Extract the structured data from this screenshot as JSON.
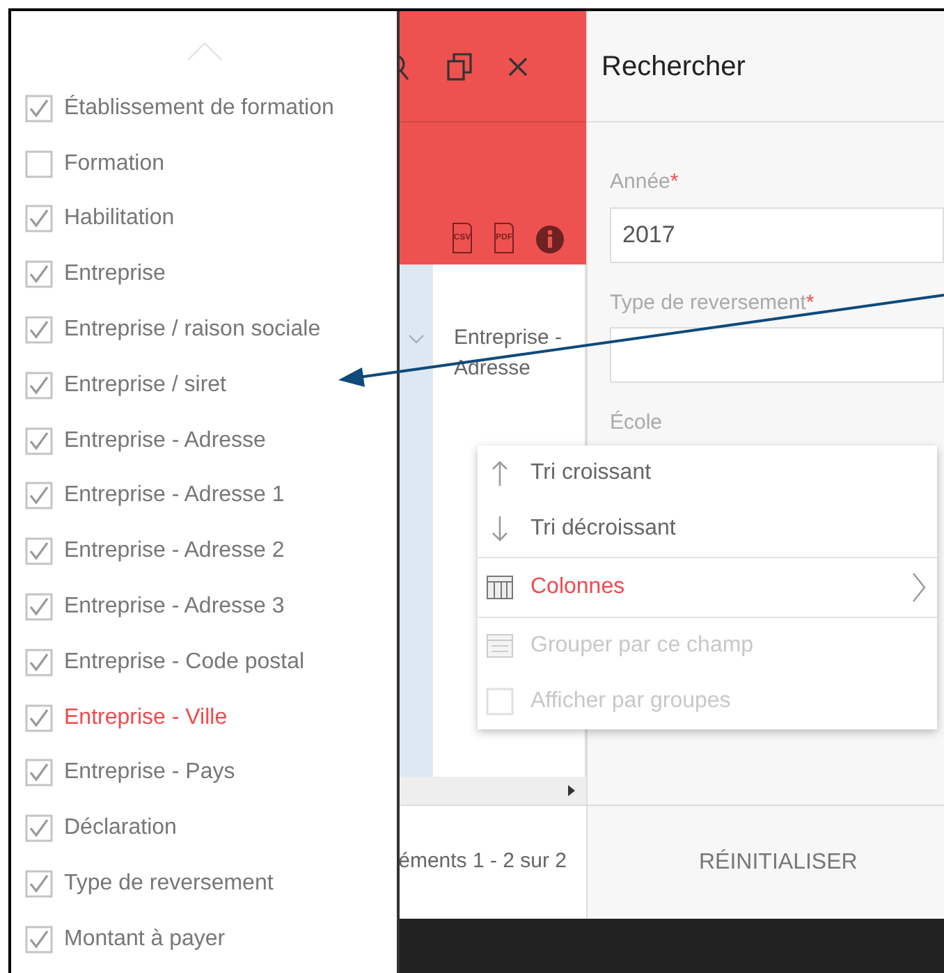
{
  "columns_panel": {
    "items": [
      {
        "label": "Établissement de formation",
        "checked": true,
        "highlighted": false
      },
      {
        "label": "Formation",
        "checked": false,
        "highlighted": false
      },
      {
        "label": "Habilitation",
        "checked": true,
        "highlighted": false
      },
      {
        "label": "Entreprise",
        "checked": true,
        "highlighted": false
      },
      {
        "label": "Entreprise / raison sociale",
        "checked": true,
        "highlighted": false
      },
      {
        "label": "Entreprise / siret",
        "checked": true,
        "highlighted": false
      },
      {
        "label": "Entreprise - Adresse",
        "checked": true,
        "highlighted": false
      },
      {
        "label": "Entreprise - Adresse 1",
        "checked": true,
        "highlighted": false
      },
      {
        "label": "Entreprise - Adresse 2",
        "checked": true,
        "highlighted": false
      },
      {
        "label": "Entreprise - Adresse 3",
        "checked": true,
        "highlighted": false
      },
      {
        "label": "Entreprise - Code postal",
        "checked": true,
        "highlighted": false
      },
      {
        "label": "Entreprise - Ville",
        "checked": true,
        "highlighted": true
      },
      {
        "label": "Entreprise - Pays",
        "checked": true,
        "highlighted": false
      },
      {
        "label": "Déclaration",
        "checked": true,
        "highlighted": false
      },
      {
        "label": "Type de reversement",
        "checked": true,
        "highlighted": false
      },
      {
        "label": "Montant à payer",
        "checked": true,
        "highlighted": false
      }
    ]
  },
  "grid": {
    "export_buttons": [
      "CSV",
      "PDF"
    ],
    "column_header": "Entreprise - Adresse",
    "pager": "éments 1 - 2 sur 2"
  },
  "search_panel": {
    "title": "Rechercher",
    "fields": [
      {
        "label": "Année",
        "required_mark": "*",
        "value": "2017"
      },
      {
        "label": "Type de reversement",
        "required_mark": "*"
      },
      {
        "label": "École"
      }
    ],
    "reset_button": "RÉINITIALISER"
  },
  "context_menu": {
    "items": [
      {
        "kind": "sort_asc",
        "label": "Tri croissant",
        "selected": false,
        "disabled": false
      },
      {
        "kind": "sort_desc",
        "label": "Tri décroissant",
        "selected": false,
        "disabled": false
      },
      {
        "kind": "submenu",
        "label": "Colonnes",
        "selected": true,
        "disabled": false
      },
      {
        "kind": "group",
        "label": "Grouper par ce champ",
        "selected": false,
        "disabled": true
      },
      {
        "kind": "checkbox",
        "label": "Afficher par groupes",
        "selected": false,
        "disabled": true,
        "checked": false
      }
    ]
  }
}
